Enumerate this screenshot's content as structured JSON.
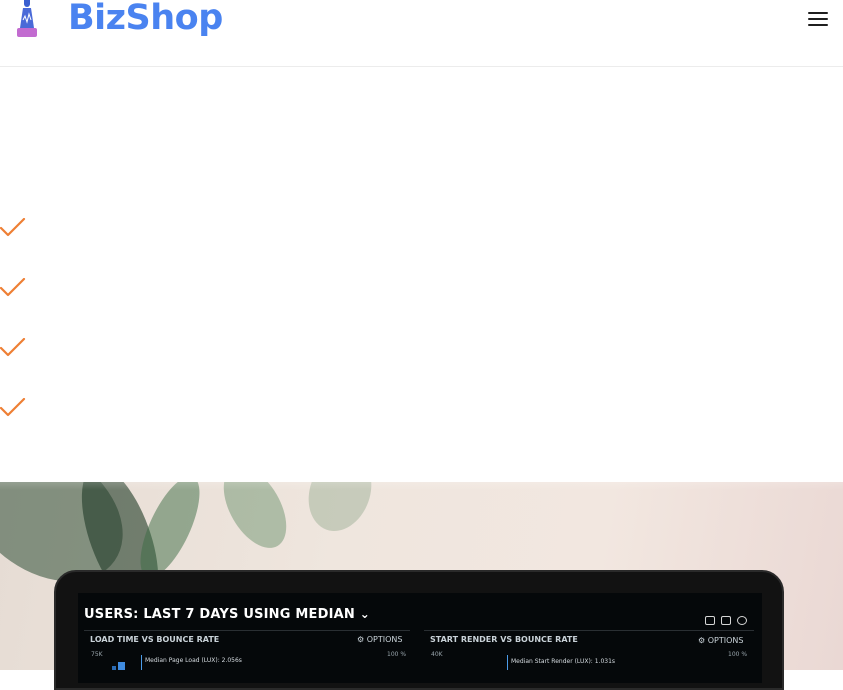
{
  "header": {
    "brand": "BizShop",
    "logo_icon": "rocket-lighthouse-icon",
    "menu_icon": "hamburger-menu-icon"
  },
  "features": {
    "items": [
      {
        "icon": "checkmark-icon",
        "label": ""
      },
      {
        "icon": "checkmark-icon",
        "label": ""
      },
      {
        "icon": "checkmark-icon",
        "label": ""
      },
      {
        "icon": "checkmark-icon",
        "label": ""
      }
    ],
    "check_color": "#ee7f34"
  },
  "colors": {
    "brand": "#4a83f0",
    "accent": "#ee7f34"
  },
  "hero_screen": {
    "title_prefix": "USERS:",
    "title_range": "LAST 7 DAYS",
    "title_using": "USING",
    "title_metric": "MEDIAN",
    "left_panel": {
      "title": "LOAD TIME VS BOUNCE RATE",
      "options": "OPTIONS",
      "y_label": "75K",
      "median": "Median Page Load (LUX): 2.056s",
      "pct": "100 %"
    },
    "right_panel": {
      "title": "START RENDER VS BOUNCE RATE",
      "options": "OPTIONS",
      "y_label": "40K",
      "median": "Median Start Render (LUX): 1.031s",
      "pct": "100 %"
    }
  }
}
